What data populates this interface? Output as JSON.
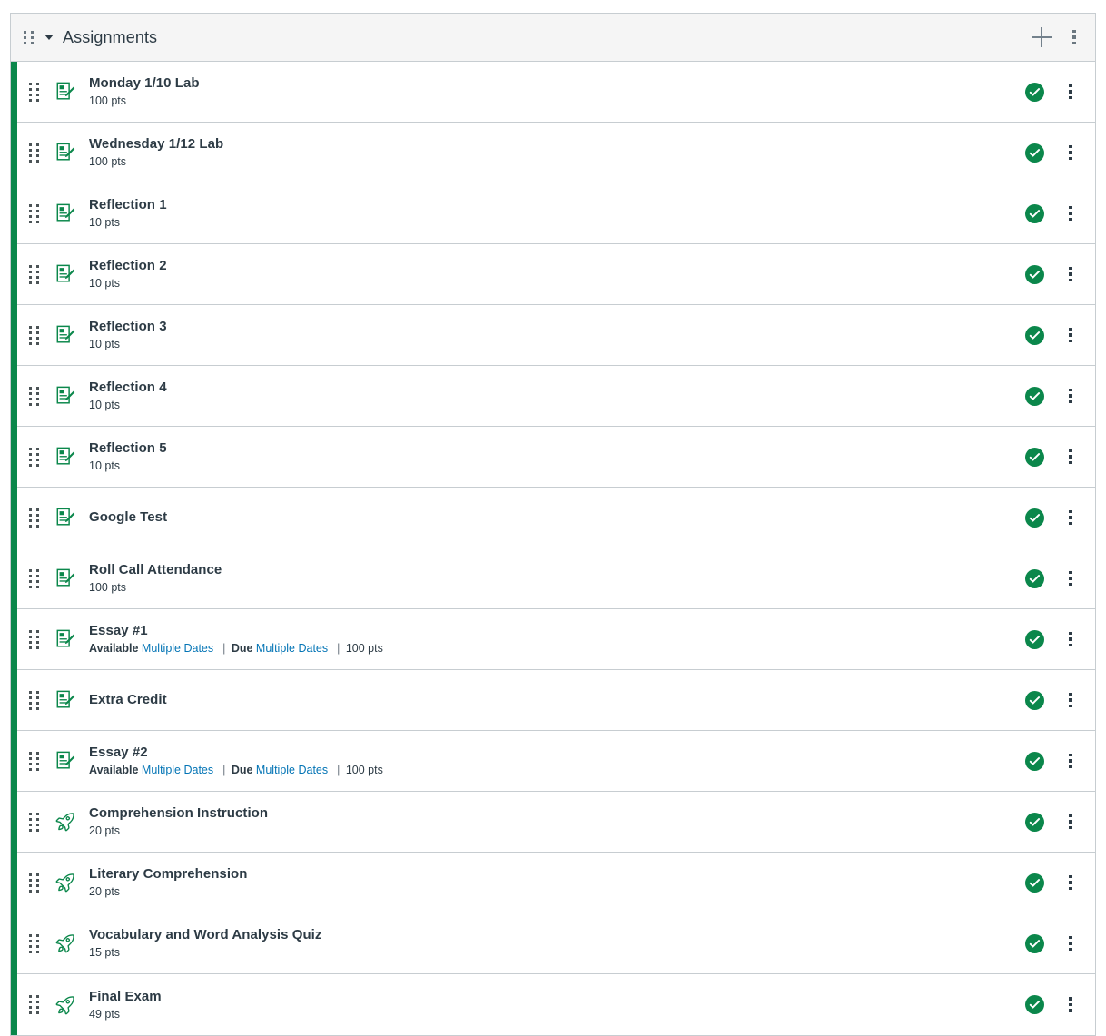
{
  "group": {
    "title": "Assignments",
    "drag_handle_icon": "drag-handle-icon",
    "collapse_icon": "chevron-down-icon",
    "add_icon": "plus-icon",
    "menu_icon": "kebab-menu-icon",
    "add_label": "+",
    "menu_label": "⋮"
  },
  "colors": {
    "group_accent": "#0b874b",
    "published": "#0b874b",
    "link": "#0374b5",
    "text": "#2d3b45",
    "border": "#c7cdd1",
    "header_bg": "#f5f5f5"
  },
  "labels": {
    "available": "Available",
    "due": "Due",
    "separator": "|",
    "published_state": "Published"
  },
  "assignments": [
    {
      "title": "Monday 1/10 Lab",
      "points": "100 pts",
      "type": "assignment",
      "icon": "assignment-icon",
      "published": true
    },
    {
      "title": "Wednesday 1/12 Lab",
      "points": "100 pts",
      "type": "assignment",
      "icon": "assignment-icon",
      "published": true
    },
    {
      "title": "Reflection 1",
      "points": "10 pts",
      "type": "assignment",
      "icon": "assignment-icon",
      "published": true
    },
    {
      "title": "Reflection 2",
      "points": "10 pts",
      "type": "assignment",
      "icon": "assignment-icon",
      "published": true
    },
    {
      "title": "Reflection 3",
      "points": "10 pts",
      "type": "assignment",
      "icon": "assignment-icon",
      "published": true
    },
    {
      "title": "Reflection 4",
      "points": "10 pts",
      "type": "assignment",
      "icon": "assignment-icon",
      "published": true
    },
    {
      "title": "Reflection 5",
      "points": "10 pts",
      "type": "assignment",
      "icon": "assignment-icon",
      "published": true
    },
    {
      "title": "Google Test",
      "points": "",
      "type": "assignment",
      "icon": "assignment-icon",
      "published": true
    },
    {
      "title": "Roll Call Attendance",
      "points": "100 pts",
      "type": "assignment",
      "icon": "assignment-icon",
      "published": true
    },
    {
      "title": "Essay #1",
      "points": "100 pts",
      "available": "Multiple Dates",
      "due": "Multiple Dates",
      "type": "assignment",
      "icon": "assignment-icon",
      "published": true
    },
    {
      "title": "Extra Credit",
      "points": "",
      "type": "assignment",
      "icon": "assignment-icon",
      "published": true
    },
    {
      "title": "Essay #2",
      "points": "100 pts",
      "available": "Multiple Dates",
      "due": "Multiple Dates",
      "type": "assignment",
      "icon": "assignment-icon",
      "published": true
    },
    {
      "title": "Comprehension Instruction",
      "points": "20 pts",
      "type": "quiz",
      "icon": "quiz-rocket-icon",
      "published": true
    },
    {
      "title": "Literary Comprehension",
      "points": "20 pts",
      "type": "quiz",
      "icon": "quiz-rocket-icon",
      "published": true
    },
    {
      "title": "Vocabulary and Word Analysis Quiz",
      "points": "15 pts",
      "type": "quiz",
      "icon": "quiz-rocket-icon",
      "published": true
    },
    {
      "title": "Final Exam",
      "points": "49 pts",
      "type": "quiz",
      "icon": "quiz-rocket-icon",
      "published": true
    }
  ]
}
